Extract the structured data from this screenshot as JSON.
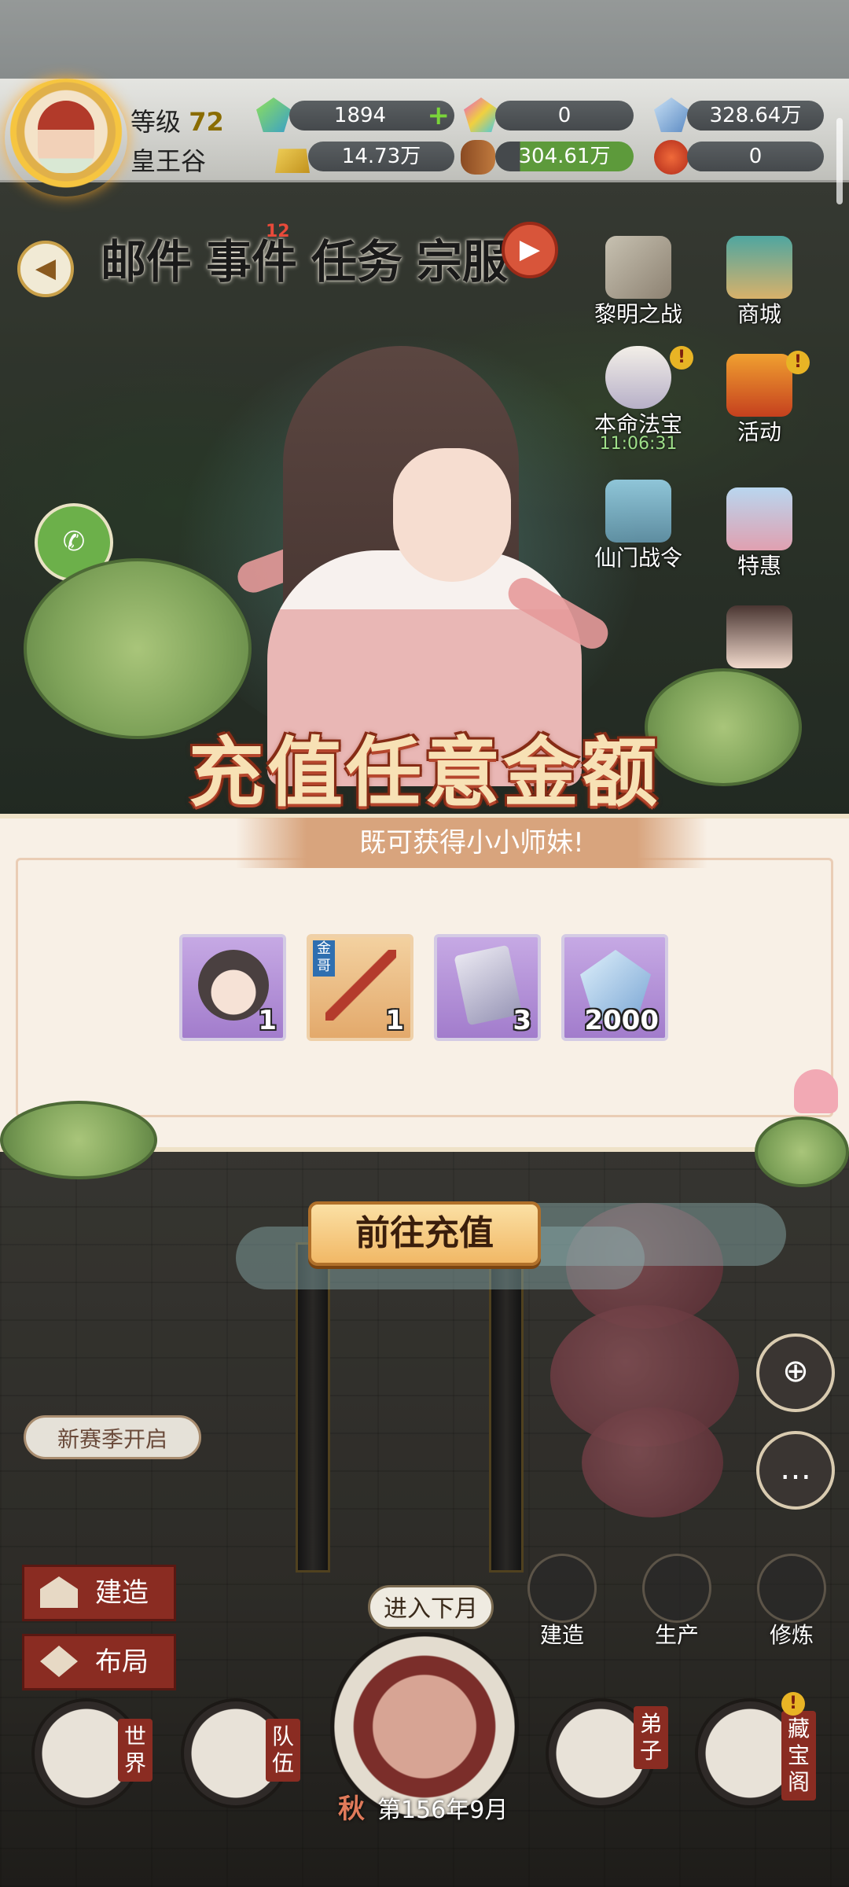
{
  "player": {
    "level_label": "等级",
    "level_value": "72",
    "location": "皇王谷"
  },
  "resources": [
    {
      "name": "jade",
      "value": "1894",
      "icon": "green-gem-icon",
      "has_plus": true
    },
    {
      "name": "rainbow-jade",
      "value": "0",
      "icon": "rainbow-gem-icon"
    },
    {
      "name": "spirit-stone",
      "value": "328.64万",
      "icon": "blue-crystal-icon"
    },
    {
      "name": "gold",
      "value": "14.73万",
      "icon": "gold-ingot-icon"
    },
    {
      "name": "wood",
      "value": "304.61万",
      "icon": "wood-log-icon"
    },
    {
      "name": "elixir",
      "value": "0",
      "icon": "red-pill-icon"
    }
  ],
  "menu": {
    "mail": "邮件",
    "events": "事件",
    "events_badge": "12",
    "tasks": "任务",
    "guest": "宗服"
  },
  "side_menu": [
    {
      "label": "黎明之战"
    },
    {
      "label": "商城"
    },
    {
      "label": "本命法宝",
      "timer": "11:06:31"
    },
    {
      "label": "活动"
    },
    {
      "label": "仙门战令"
    },
    {
      "label": "特惠"
    }
  ],
  "promo": {
    "title": "充值任意金额",
    "subtitle": "既可获得小小师妹!",
    "items": [
      {
        "icon": "girl-avatar-icon",
        "count": "1"
      },
      {
        "icon": "sword-icon",
        "count": "1",
        "tag": "金哥"
      },
      {
        "icon": "ticket-icon",
        "count": "3"
      },
      {
        "icon": "blue-crystal-icon",
        "count": "2000"
      }
    ],
    "cta": "前往充值"
  },
  "bottom": {
    "season_notice": "新赛季开启",
    "build": "建造",
    "layout": "布局",
    "next_month": "进入下月",
    "season": "秋",
    "date": "第156年9月",
    "world": "世界",
    "team": "队伍",
    "disciple": "弟子",
    "treasury": "藏宝阁",
    "actions": {
      "build": "建造",
      "produce": "生产",
      "cultivate": "修炼"
    }
  }
}
